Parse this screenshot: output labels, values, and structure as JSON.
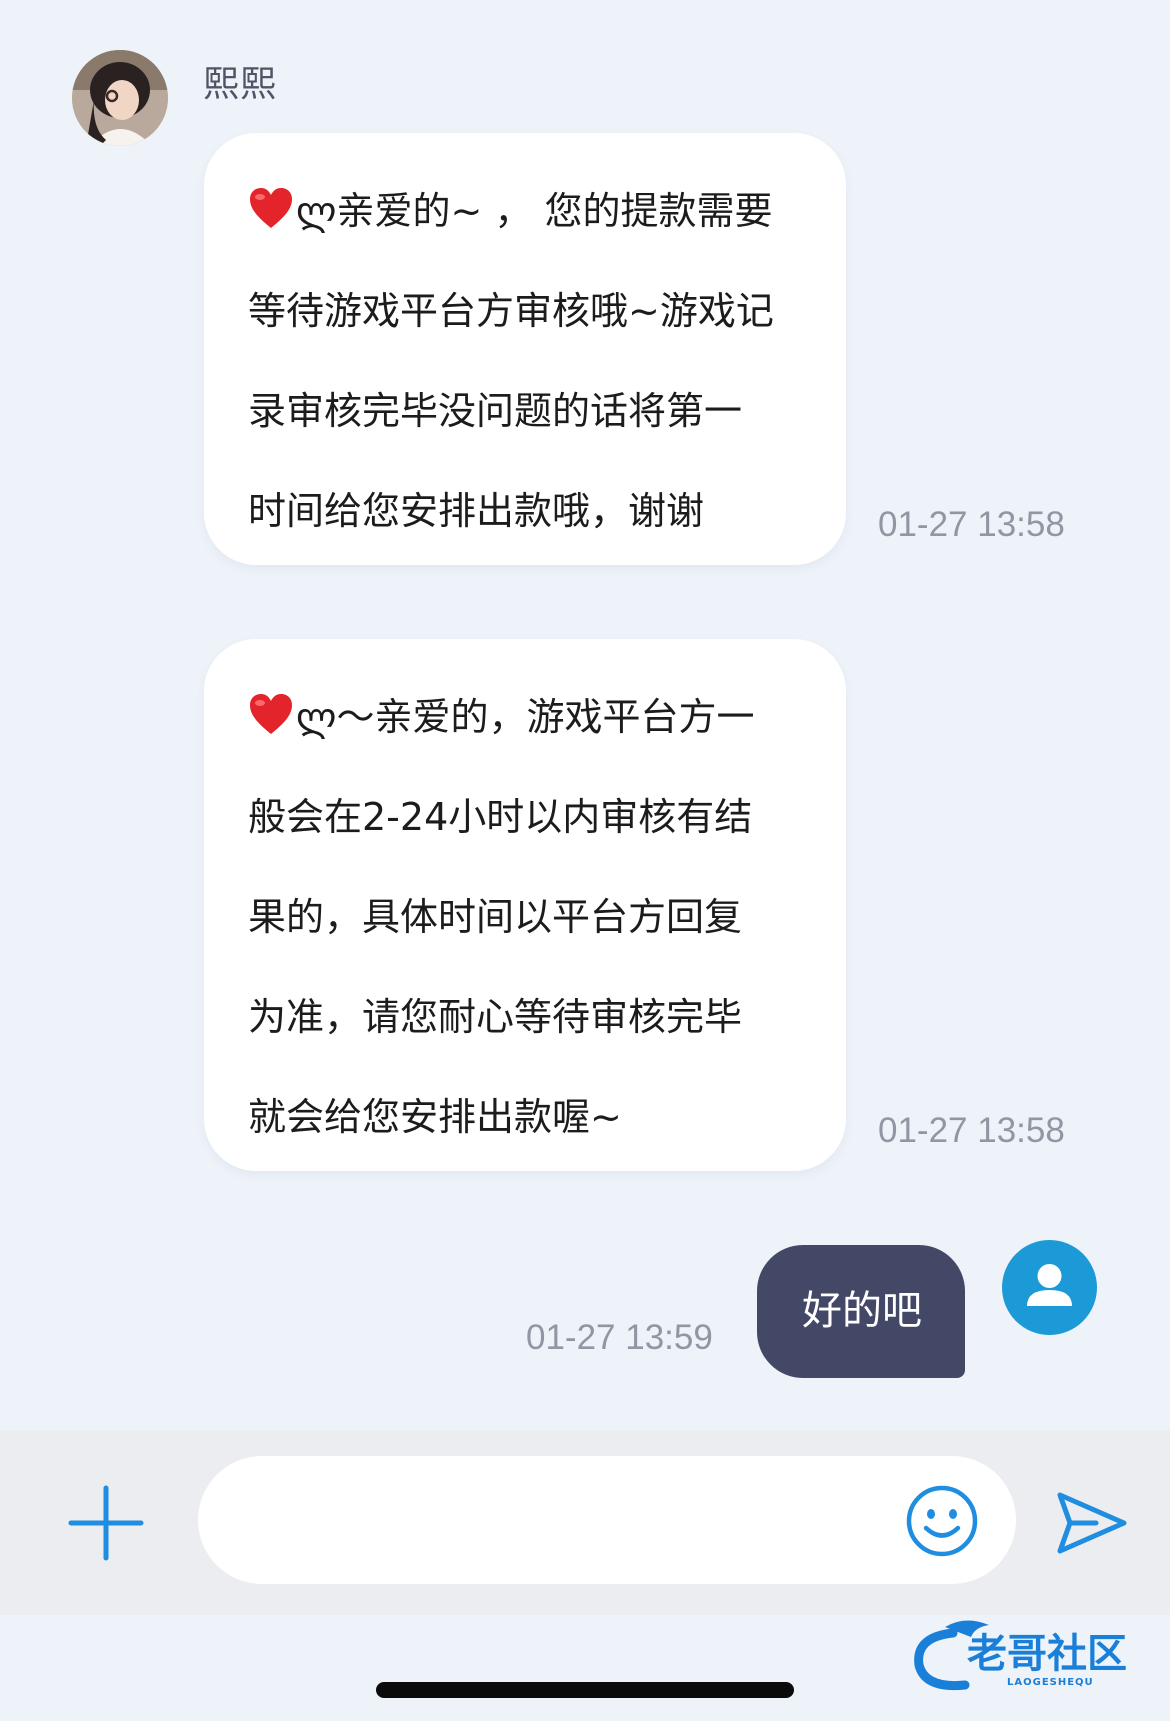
{
  "contact": {
    "name": "熙熙",
    "avatar_icon": "contact-photo-avatar"
  },
  "messages": [
    {
      "side": "incoming",
      "prefix_icon": "red-heart-emoji",
      "lines": [
        "ლ亲爱的~ ， 您的提款需要",
        "等待游戏平台方审核哦~游戏记",
        "录审核完毕没问题的话将第一",
        "时间给您安排出款哦，谢谢"
      ],
      "timestamp": "01-27 13:58"
    },
    {
      "side": "incoming",
      "prefix_icon": "red-heart-emoji",
      "lines": [
        "ლ～亲爱的，游戏平台方一",
        "般会在2-24小时以内审核有结",
        "果的，具体时间以平台方回复",
        "为准，请您耐心等待审核完毕",
        "就会给您安排出款喔~"
      ],
      "timestamp": "01-27 13:58"
    },
    {
      "side": "outgoing",
      "text": "好的吧",
      "timestamp": "01-27 13:59",
      "avatar_icon": "user-avatar-icon"
    }
  ],
  "composer": {
    "placeholder": "",
    "plus_icon": "plus-icon",
    "emoji_icon": "smiley-icon",
    "send_icon": "send-icon"
  },
  "watermark": {
    "text": "老哥社区",
    "subtext": "LAOGESHEQU"
  },
  "colors": {
    "chat_background": "#eef3f9",
    "incoming_bubble": "#ffffff",
    "outgoing_bubble": "#434867",
    "accent_blue": "#1c9ad8",
    "timestamp_gray": "#9097a3"
  }
}
